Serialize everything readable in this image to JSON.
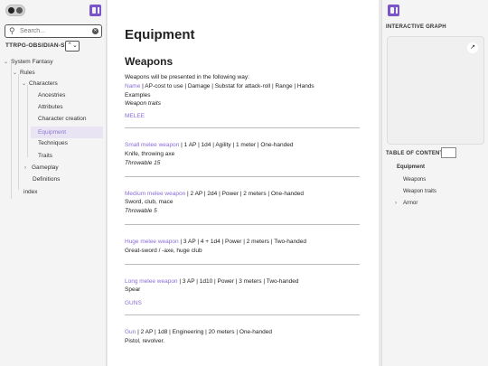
{
  "vault": {
    "name": "TTRPG-OBSIDIAN-SYNC",
    "collapse_glyph": "⌃⌄"
  },
  "search": {
    "placeholder": "Search..."
  },
  "tree": [
    {
      "label": "System Fantasy",
      "chevron": "⌄"
    },
    {
      "label": "Rules",
      "chevron": "⌄"
    },
    {
      "label": "Characters",
      "chevron": "⌄"
    },
    {
      "label": "Ancestries"
    },
    {
      "label": "Attributes"
    },
    {
      "label": "Character creation"
    },
    {
      "label": "Equipment"
    },
    {
      "label": "Techniques"
    },
    {
      "label": "Traits"
    },
    {
      "label": "Gameplay",
      "chevron": "›"
    },
    {
      "label": "Definitions"
    },
    {
      "label": "index"
    }
  ],
  "page": {
    "title": "Equipment",
    "section": "Weapons",
    "intro": "Weapons will be presented in the following way:",
    "format_name": "Name",
    "format_rest": " | AP-cost to use | Damage | Substat for attack-roll | Range | Hands",
    "format_examples": "Examples",
    "format_traits": "Weapon traits",
    "melee_heading": "MELEE",
    "guns_heading": "GUNS",
    "weapons": [
      {
        "name": "Small melee weapon",
        "stats": " | 1 AP | 1d4 | Agility | 1 meter | One-handed",
        "examples": "Knife, throwing axe",
        "traits": "Throwable 15"
      },
      {
        "name": "Medium melee weapon",
        "stats": " | 2 AP | 2d4 | Power | 2 meters | One-handed",
        "examples": "Sword, club, mace",
        "traits": "Throwable 5"
      },
      {
        "name": "Huge melee weapon",
        "stats": " | 3 AP | 4 + 1d4 | Power | 2 meters | Two-handed",
        "examples": "Great-sword / -axe, huge club",
        "traits": ""
      },
      {
        "name": "Long melee weapon",
        "stats": " | 3 AP | 1d10 | Power | 3 meters | Two-handed",
        "examples": "Spear",
        "traits": ""
      },
      {
        "name": "Gun",
        "stats": " | 2 AP | 1d8 | Engineering | 20 meters | One-handed",
        "examples": "Pistol, revolver.",
        "traits": ""
      }
    ]
  },
  "right": {
    "graph_label": "INTERACTIVE GRAPH",
    "open_glyph": "↗",
    "toc_label": "TABLE OF CONTENTS",
    "toc": [
      {
        "label": "Equipment"
      },
      {
        "label": "Weapons"
      },
      {
        "label": "Weapon traits"
      },
      {
        "label": "Armor",
        "chevron": "›"
      }
    ]
  },
  "colors": {
    "accent": "#8a6cd4",
    "active_bg": "#e8e4f3"
  },
  "icons": [
    "theme-toggle-icon",
    "sidebar-toggle-icon",
    "search-icon",
    "clear-search-icon",
    "open-graph-icon"
  ]
}
